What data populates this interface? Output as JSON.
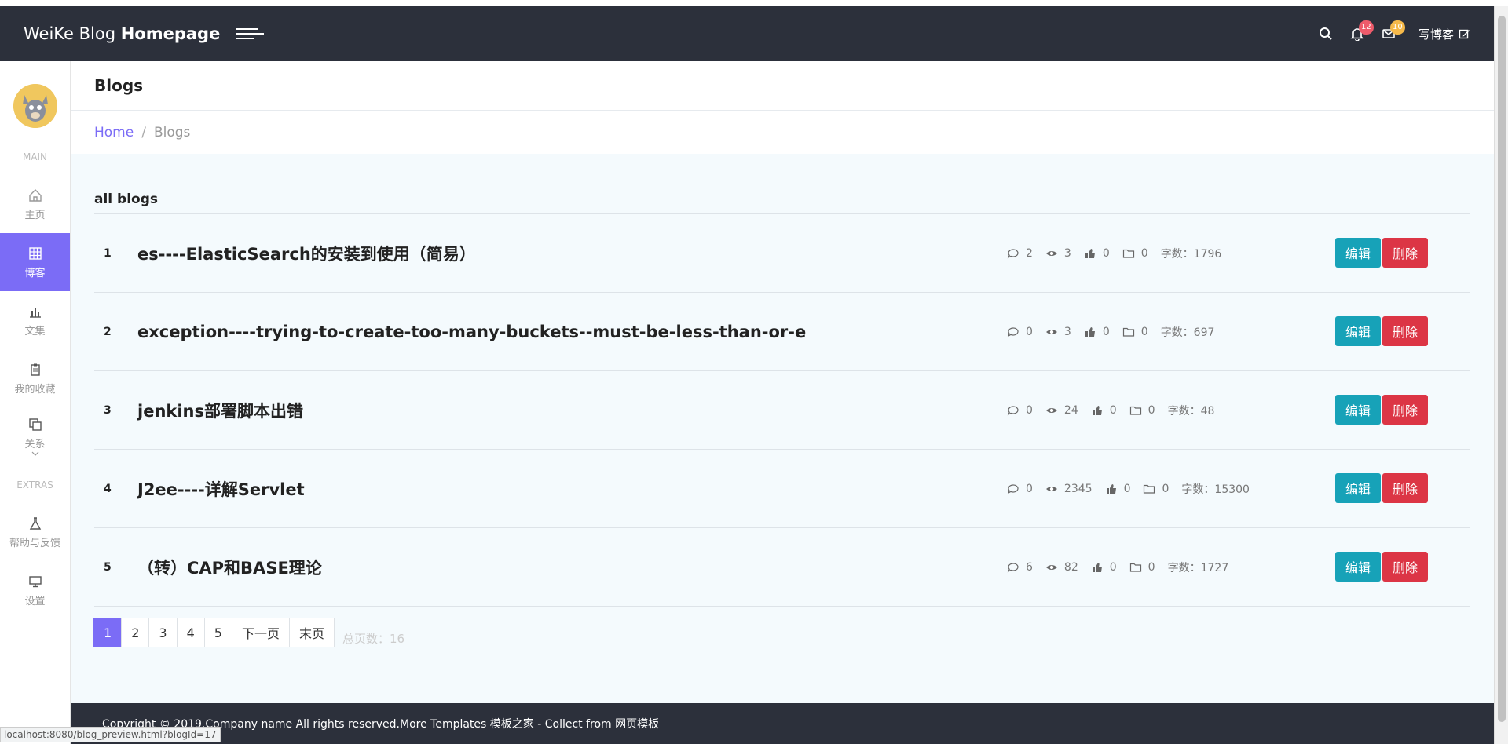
{
  "header": {
    "brand_light": "WeiKe Blog ",
    "brand_bold": "Homepage",
    "notif_count": "12",
    "mail_count": "10",
    "write_label": "写博客",
    "colors": {
      "bar": "#2c303b",
      "notif_badge": "#ee5b6b",
      "mail_badge": "#f6b94a"
    }
  },
  "sidebar": {
    "section_main": "MAIN",
    "section_extras": "EXTRAS",
    "items": [
      {
        "label": "主页",
        "icon": "home-icon"
      },
      {
        "label": "博客",
        "icon": "grid-icon",
        "active": true
      },
      {
        "label": "文集",
        "icon": "bar-chart-icon"
      },
      {
        "label": "我的收藏",
        "icon": "clipboard-icon"
      },
      {
        "label": "关系",
        "icon": "copy-icon"
      },
      {
        "label": "帮助与反馈",
        "icon": "flask-icon"
      },
      {
        "label": "设置",
        "icon": "monitor-icon"
      }
    ],
    "accent": "#7b6cf6"
  },
  "page": {
    "title": "Blogs",
    "breadcrumb_home": "Home",
    "breadcrumb_sep": "/",
    "breadcrumb_current": "Blogs",
    "list_title": "all blogs"
  },
  "blogs": [
    {
      "num": "1",
      "title": "es----ElasticSearch的安装到使用（简易）",
      "comments": "2",
      "views": "3",
      "likes": "0",
      "folders": "0",
      "words": "字数：1796"
    },
    {
      "num": "2",
      "title": "exception----trying-to-create-too-many-buckets--must-be-less-than-or-e",
      "comments": "0",
      "views": "3",
      "likes": "0",
      "folders": "0",
      "words": "字数：697"
    },
    {
      "num": "3",
      "title": "jenkins部署脚本出错",
      "comments": "0",
      "views": "24",
      "likes": "0",
      "folders": "0",
      "words": "字数：48"
    },
    {
      "num": "4",
      "title": "J2ee----详解Servlet",
      "comments": "0",
      "views": "2345",
      "likes": "0",
      "folders": "0",
      "words": "字数：15300"
    },
    {
      "num": "5",
      "title": "（转）CAP和BASE理论",
      "comments": "6",
      "views": "82",
      "likes": "0",
      "folders": "0",
      "words": "字数：1727"
    }
  ],
  "actions": {
    "edit": "编辑",
    "delete": "删除"
  },
  "pagination": {
    "pages": [
      "1",
      "2",
      "3",
      "4",
      "5"
    ],
    "next": "下一页",
    "last": "末页",
    "total": "总页数：16"
  },
  "footer": {
    "text": "Copyright © 2019.Company name All rights reserved.More Templates 模板之家 - Collect from 网页模板"
  },
  "status_url": "localhost:8080/blog_preview.html?blogId=17"
}
